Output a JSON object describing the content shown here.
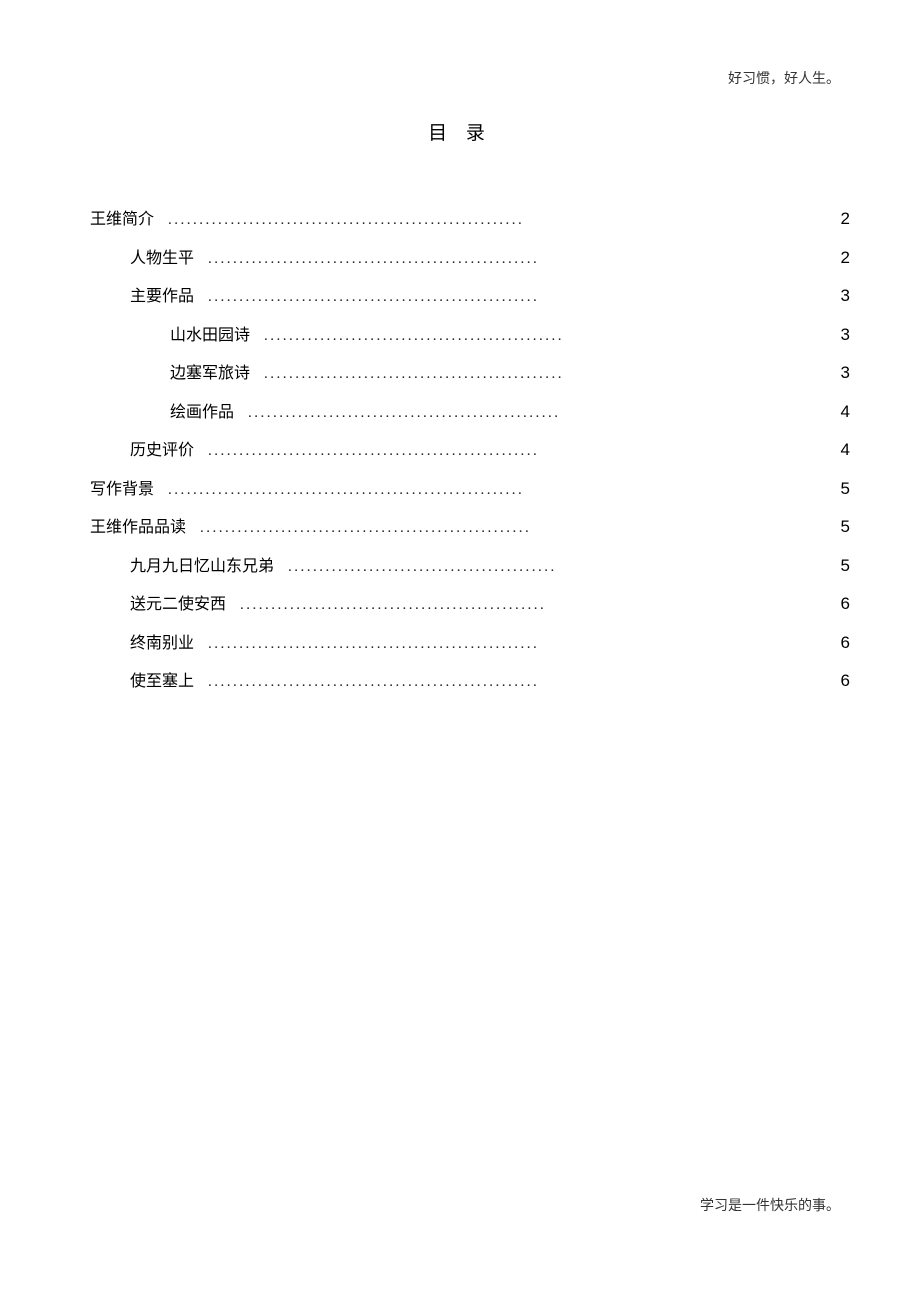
{
  "header": "好习惯，好人生。",
  "title": "目 录",
  "footer": "学习是一件快乐的事。",
  "toc": [
    {
      "label": "王维简介",
      "page": "2",
      "indent": 0,
      "dots": "........................................................."
    },
    {
      "label": "人物生平",
      "page": "2",
      "indent": 1,
      "dots": "....................................................."
    },
    {
      "label": "主要作品",
      "page": "3",
      "indent": 1,
      "dots": "....................................................."
    },
    {
      "label": "山水田园诗",
      "page": "3",
      "indent": 2,
      "dots": "................................................"
    },
    {
      "label": "边塞军旅诗",
      "page": "3",
      "indent": 2,
      "dots": "................................................"
    },
    {
      "label": "绘画作品",
      "page": "4",
      "indent": 2,
      "dots": ".................................................."
    },
    {
      "label": "历史评价",
      "page": "4",
      "indent": 1,
      "dots": "....................................................."
    },
    {
      "label": "写作背景",
      "page": "5",
      "indent": 0,
      "dots": "........................................................."
    },
    {
      "label": "王维作品品读",
      "page": "5",
      "indent": 0,
      "dots": "....................................................."
    },
    {
      "label": "九月九日忆山东兄弟",
      "page": "5",
      "indent": 1,
      "dots": "..........................................."
    },
    {
      "label": "送元二使安西",
      "page": "6",
      "indent": 1,
      "dots": "................................................."
    },
    {
      "label": "终南别业",
      "page": "6",
      "indent": 1,
      "dots": "....................................................."
    },
    {
      "label": "使至塞上",
      "page": "6",
      "indent": 1,
      "dots": "....................................................."
    }
  ]
}
